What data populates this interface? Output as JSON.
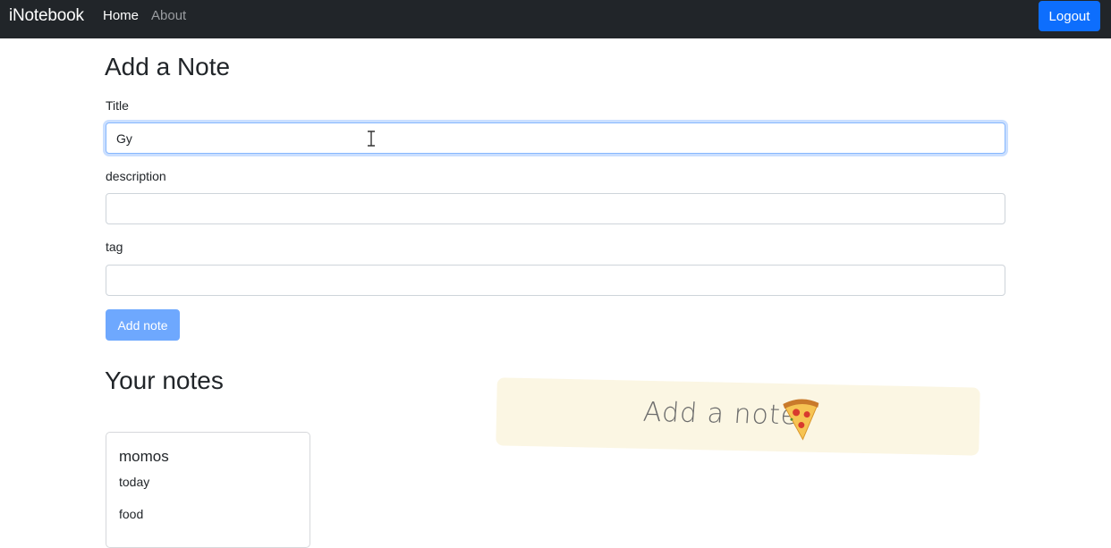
{
  "navbar": {
    "brand": "iNotebook",
    "links": [
      {
        "label": "Home"
      },
      {
        "label": "About"
      }
    ],
    "logout_label": "Logout"
  },
  "form": {
    "heading": "Add a Note",
    "title_label": "Title",
    "title_value": "Gy",
    "description_label": "description",
    "description_value": "",
    "tag_label": "tag",
    "tag_value": "",
    "submit_label": "Add note"
  },
  "notes": {
    "heading": "Your notes",
    "items": [
      {
        "title": "momos",
        "description": "today",
        "tag": "food"
      }
    ]
  },
  "toast": {
    "text": "Add a note",
    "icon": "pizza-icon"
  },
  "colors": {
    "navbar_bg": "#212529",
    "primary": "#0d6efd",
    "primary_disabled": "#6ea8fe",
    "toast_bg": "#fbf6e3"
  }
}
